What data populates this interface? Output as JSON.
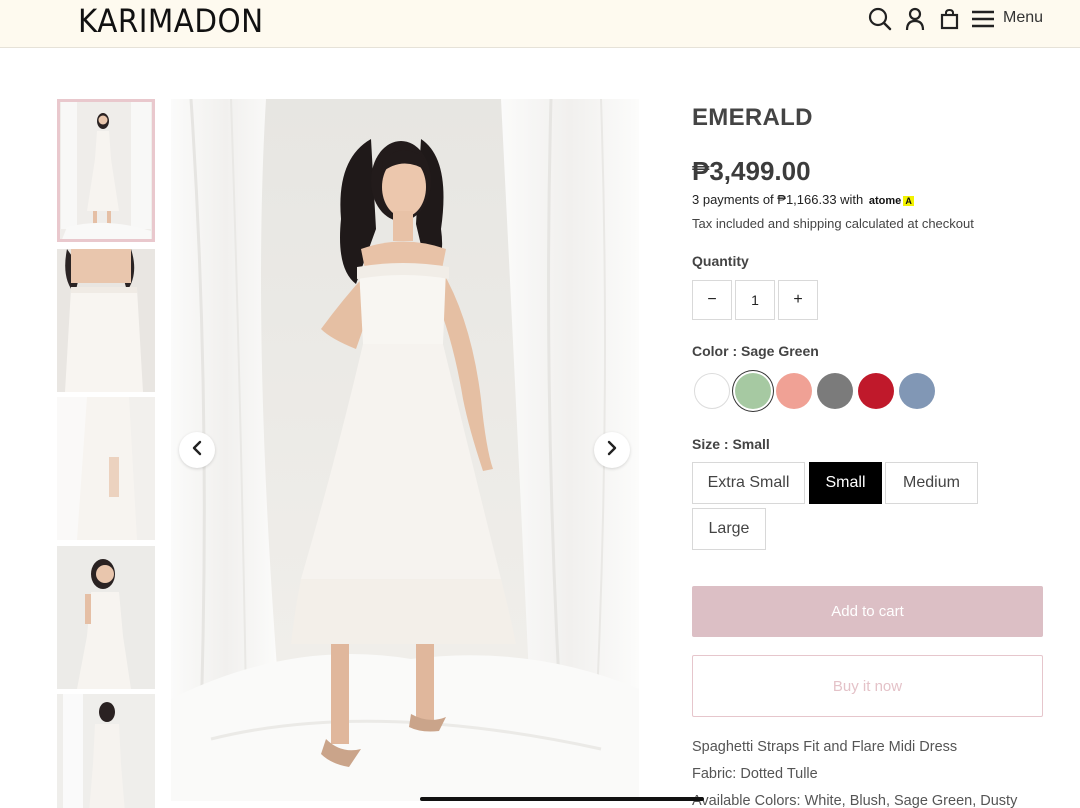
{
  "header": {
    "logo": "KARIMADON",
    "menu_label": "Menu",
    "icons": [
      "search-icon",
      "account-icon",
      "cart-bag-icon",
      "hamburger-menu-icon"
    ]
  },
  "gallery": {
    "thumbnails": [
      {
        "label": "full-length-front"
      },
      {
        "label": "bodice-close-up"
      },
      {
        "label": "skirt-detail"
      },
      {
        "label": "upper-body-pose"
      },
      {
        "label": "back-view"
      }
    ],
    "active_thumbnail": 0,
    "nav_icons": [
      "chevron-left-icon",
      "chevron-right-icon"
    ]
  },
  "product": {
    "title": "EMERALD",
    "price": "₱3,499.00",
    "payments_text": "3 payments of ₱1,166.33 with",
    "payments_brand": "atome",
    "payments_brand_mark": "A",
    "tax_text": "Tax included and shipping calculated at checkout",
    "quantity_label": "Quantity",
    "quantity": {
      "minus": "−",
      "value": "1",
      "plus": "+"
    },
    "color_label": "Color : Sage Green",
    "colors": [
      {
        "name": "White",
        "hex": "#ffffff"
      },
      {
        "name": "Sage Green",
        "hex": "#a6c9a2",
        "selected": true
      },
      {
        "name": "Blush",
        "hex": "#f0a195"
      },
      {
        "name": "Grey",
        "hex": "#7b7b7b"
      },
      {
        "name": "Red",
        "hex": "#c0192b"
      },
      {
        "name": "Dusty Blue",
        "hex": "#8197b5"
      }
    ],
    "size_label": "Size : Small",
    "sizes": [
      {
        "label": "Extra Small"
      },
      {
        "label": "Small",
        "selected": true
      },
      {
        "label": "Medium"
      },
      {
        "label": "Large"
      }
    ],
    "add_to_cart": "Add to cart",
    "buy_now": "Buy it now",
    "description_lines": [
      "Spaghetti Straps Fit and Flare Midi Dress",
      "Fabric: Dotted Tulle",
      "Available Colors: White, Blush, Sage Green, Dusty"
    ]
  },
  "colors": {
    "header_bg": "#fefaef",
    "accent_pink": "#dcbfc5",
    "selected_size_bg": "#000000"
  }
}
